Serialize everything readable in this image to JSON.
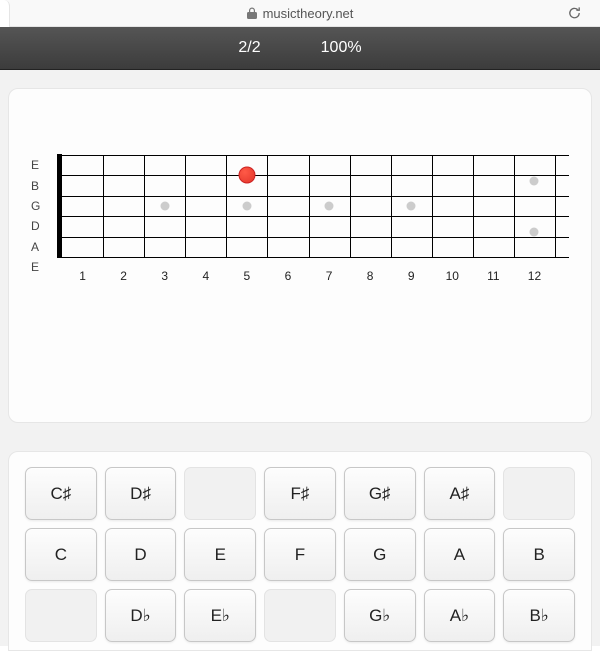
{
  "browser": {
    "domain": "musictheory.net"
  },
  "score": {
    "progress": "2/2",
    "percent": "100%"
  },
  "fretboard": {
    "tuning": [
      "E",
      "B",
      "G",
      "D",
      "A",
      "E"
    ],
    "frets": 12,
    "fret_labels": [
      "1",
      "2",
      "3",
      "4",
      "5",
      "6",
      "7",
      "8",
      "9",
      "10",
      "11",
      "12"
    ],
    "markers": [
      {
        "fret": 3,
        "pos": 0.5
      },
      {
        "fret": 5,
        "pos": 0.5
      },
      {
        "fret": 7,
        "pos": 0.5
      },
      {
        "fret": 9,
        "pos": 0.5
      },
      {
        "fret": 12,
        "pos": 0.25
      },
      {
        "fret": 12,
        "pos": 0.75
      }
    ],
    "note": {
      "string": 2,
      "fret": 5
    }
  },
  "keyboard": {
    "rows": [
      [
        {
          "label": "C♯",
          "active": true
        },
        {
          "label": "D♯",
          "active": true
        },
        {
          "label": "",
          "active": false
        },
        {
          "label": "F♯",
          "active": true
        },
        {
          "label": "G♯",
          "active": true
        },
        {
          "label": "A♯",
          "active": true
        },
        {
          "label": "",
          "active": false
        }
      ],
      [
        {
          "label": "C",
          "active": true
        },
        {
          "label": "D",
          "active": true
        },
        {
          "label": "E",
          "active": true
        },
        {
          "label": "F",
          "active": true
        },
        {
          "label": "G",
          "active": true
        },
        {
          "label": "A",
          "active": true
        },
        {
          "label": "B",
          "active": true
        }
      ],
      [
        {
          "label": "",
          "active": false
        },
        {
          "label": "D♭",
          "active": true
        },
        {
          "label": "E♭",
          "active": true
        },
        {
          "label": "",
          "active": false
        },
        {
          "label": "G♭",
          "active": true
        },
        {
          "label": "A♭",
          "active": true
        },
        {
          "label": "B♭",
          "active": true
        }
      ]
    ]
  }
}
